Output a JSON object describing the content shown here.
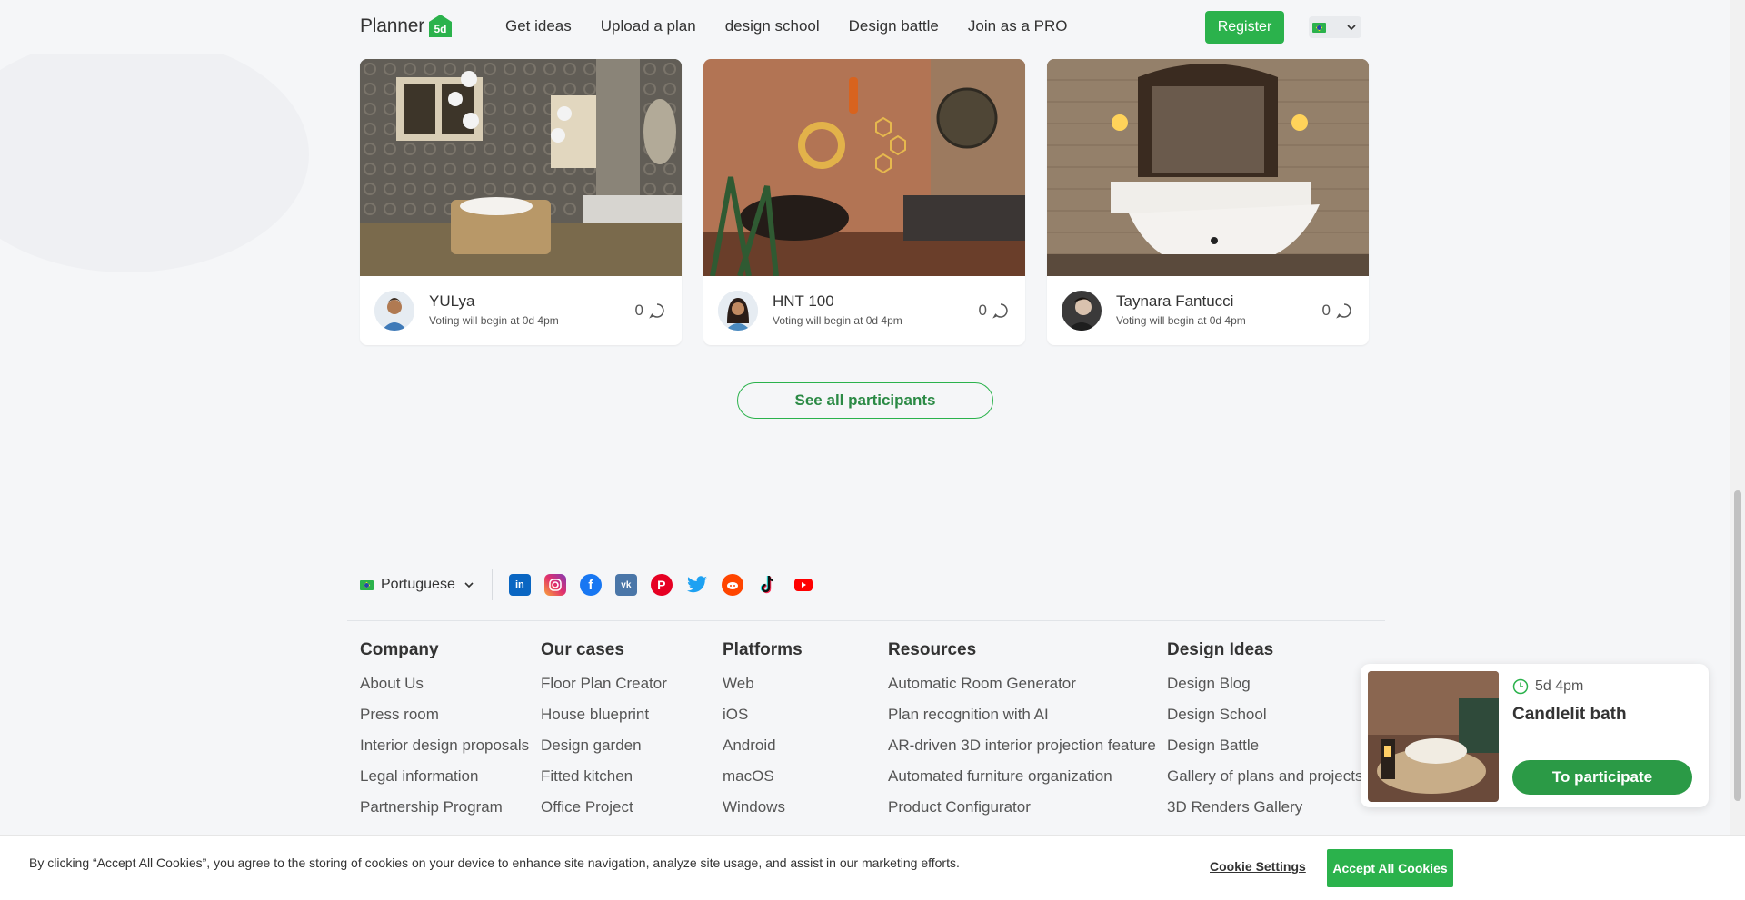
{
  "header": {
    "logo_text": "Planner",
    "logo_mark": "5d",
    "nav": [
      "Get ideas",
      "Upload a plan",
      "design school",
      "Design battle",
      "Join as a PRO"
    ],
    "register_label": "Register"
  },
  "cards": [
    {
      "author": "YULya",
      "note": "Voting will begin at 0d 4pm",
      "comments": "0"
    },
    {
      "author": "HNT 100",
      "note": "Voting will begin at 0d 4pm",
      "comments": "0"
    },
    {
      "author": "Taynara Fantucci",
      "note": "Voting will begin at 0d 4pm",
      "comments": "0"
    }
  ],
  "see_all_label": "See all participants",
  "footer": {
    "language": "Portuguese",
    "socials": [
      "linkedin-icon",
      "instagram-icon",
      "facebook-icon",
      "vk-icon",
      "pinterest-icon",
      "twitter-icon",
      "reddit-icon",
      "tiktok-icon",
      "youtube-icon"
    ],
    "columns": [
      {
        "title": "Company",
        "links": [
          "About Us",
          "Press room",
          "Interior design proposals",
          "Legal information",
          "Partnership Program"
        ]
      },
      {
        "title": "Our cases",
        "links": [
          "Floor Plan Creator",
          "House blueprint",
          "Design garden",
          "Fitted kitchen",
          "Office Project"
        ]
      },
      {
        "title": "Platforms",
        "links": [
          "Web",
          "iOS",
          "Android",
          "macOS",
          "Windows"
        ]
      },
      {
        "title": "Resources",
        "links": [
          "Automatic Room Generator",
          "Plan recognition with AI",
          "AR-driven 3D interior projection feature",
          "Automated furniture organization",
          "Product Configurator"
        ]
      },
      {
        "title": "Design Ideas",
        "links": [
          "Design Blog",
          "Design School",
          "Design Battle",
          "Gallery of plans and projects",
          "3D Renders Gallery"
        ]
      }
    ]
  },
  "popup": {
    "time": "5d 4pm",
    "title": "Candlelit bath",
    "button": "To participate"
  },
  "cookie": {
    "text": "By clicking “Accept All Cookies”, you agree to the storing of cookies on your device to enhance site navigation, analyze site usage, and assist in our marketing efforts.",
    "settings": "Cookie Settings",
    "accept": "Accept All Cookies"
  },
  "colors": {
    "brand_green": "#2bb24c",
    "page_bg": "#f5f6f8"
  }
}
